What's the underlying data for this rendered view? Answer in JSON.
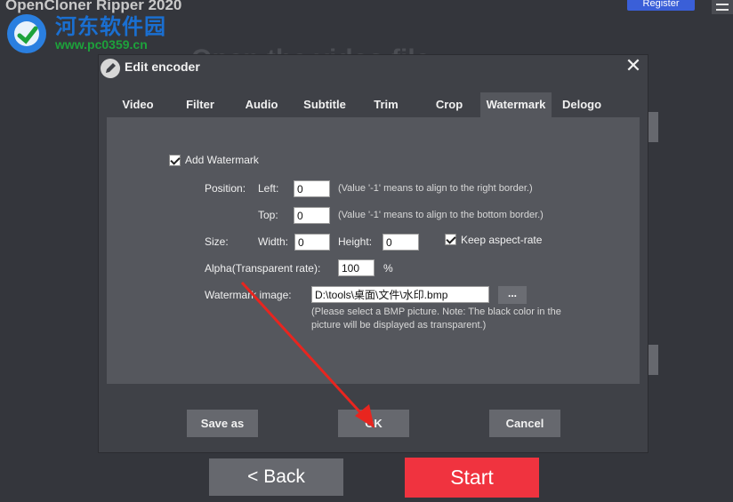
{
  "app": {
    "title": "OpenCloner Ripper 2020",
    "register_label": "Register",
    "background_heading": "Open the video file"
  },
  "watermark_site": {
    "name_cn": "河东软件园",
    "url": "www.pc0359.cn"
  },
  "dialog": {
    "title": "Edit encoder",
    "close_glyph": "✕",
    "tabs": [
      {
        "label": "Video"
      },
      {
        "label": "Filter"
      },
      {
        "label": "Audio"
      },
      {
        "label": "Subtitle"
      },
      {
        "label": "Trim"
      },
      {
        "label": "Crop"
      },
      {
        "label": "Watermark"
      },
      {
        "label": "Delogo"
      }
    ],
    "active_tab": "Watermark",
    "add_watermark": {
      "label": "Add Watermark",
      "checked": true
    },
    "position": {
      "label": "Position:",
      "left_label": "Left:",
      "left_value": "0",
      "left_hint": "(Value '-1' means to align to the right border.)",
      "top_label": "Top:",
      "top_value": "0",
      "top_hint": "(Value '-1' means to align to the bottom border.)"
    },
    "size": {
      "label": "Size:",
      "width_label": "Width:",
      "width_value": "0",
      "height_label": "Height:",
      "height_value": "0",
      "keep_aspect_label": "Keep aspect-rate",
      "keep_aspect_checked": true
    },
    "alpha": {
      "label": "Alpha(Transparent rate):",
      "value": "100",
      "unit": "%"
    },
    "image": {
      "label": "Watermark image:",
      "value": "D:\\tools\\桌面\\文件\\水印.bmp",
      "browse_label": "...",
      "note_line1": "(Please select a BMP picture. Note: The black color in the",
      "note_line2": "picture will be displayed as transparent.)"
    },
    "buttons": {
      "save_as": "Save as",
      "ok": "OK",
      "cancel": "Cancel"
    }
  },
  "footer": {
    "back_label": "<  Back",
    "start_label": "Start"
  },
  "colors": {
    "background": "#34363c",
    "dialog": "#3f4147",
    "panel": "#55575d",
    "start": "#f0333f",
    "register": "#3a5fd8",
    "annotation_arrow": "#e8251f"
  }
}
